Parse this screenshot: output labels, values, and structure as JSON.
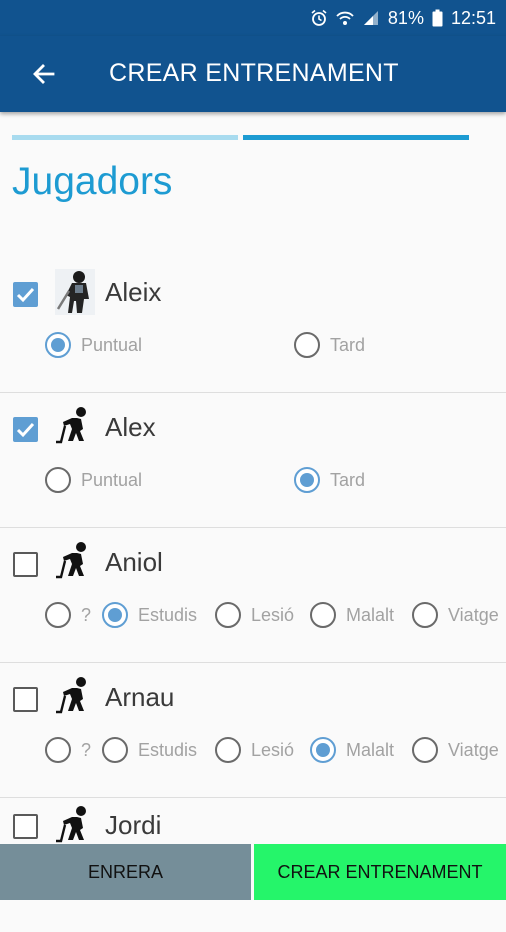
{
  "status_bar": {
    "battery": "81%",
    "time": "12:51",
    "icons": [
      "alarm-icon",
      "wifi-icon",
      "signal-icon",
      "battery-icon"
    ]
  },
  "app_bar": {
    "title": "CREAR ENTRENAMENT",
    "back_icon": "arrow-left-icon"
  },
  "stepper": {
    "steps": 2,
    "current": 2
  },
  "heading": "Jugadors",
  "players": [
    {
      "name": "Aleix",
      "checked": true,
      "avatar": "hockey-goalie-icon",
      "options": [
        {
          "label": "Puntual",
          "selected": true
        },
        {
          "label": "Tard",
          "selected": false
        }
      ]
    },
    {
      "name": "Alex",
      "checked": true,
      "avatar": "hockey-player-icon",
      "options": [
        {
          "label": "Puntual",
          "selected": false
        },
        {
          "label": "Tard",
          "selected": true
        }
      ]
    },
    {
      "name": "Aniol",
      "checked": false,
      "avatar": "hockey-player-icon",
      "options": [
        {
          "label": "?",
          "selected": false
        },
        {
          "label": "Estudis",
          "selected": true
        },
        {
          "label": "Lesió",
          "selected": false
        },
        {
          "label": "Malalt",
          "selected": false
        },
        {
          "label": "Viatge",
          "selected": false
        }
      ]
    },
    {
      "name": "Arnau",
      "checked": false,
      "avatar": "hockey-player-icon",
      "options": [
        {
          "label": "?",
          "selected": false
        },
        {
          "label": "Estudis",
          "selected": false
        },
        {
          "label": "Lesió",
          "selected": false
        },
        {
          "label": "Malalt",
          "selected": true
        },
        {
          "label": "Viatge",
          "selected": false
        }
      ]
    },
    {
      "name": "Jordi",
      "checked": false,
      "avatar": "hockey-player-icon",
      "options": []
    }
  ],
  "buttons": {
    "back": "ENRERA",
    "create": "CREAR ENTRENAMENT"
  },
  "colors": {
    "primary": "#11538f",
    "accent": "#1d9bd2",
    "accent_light": "#a8dbef",
    "selection": "#5f9ed3",
    "back_button": "#758e99",
    "create_button": "#25f56a"
  }
}
